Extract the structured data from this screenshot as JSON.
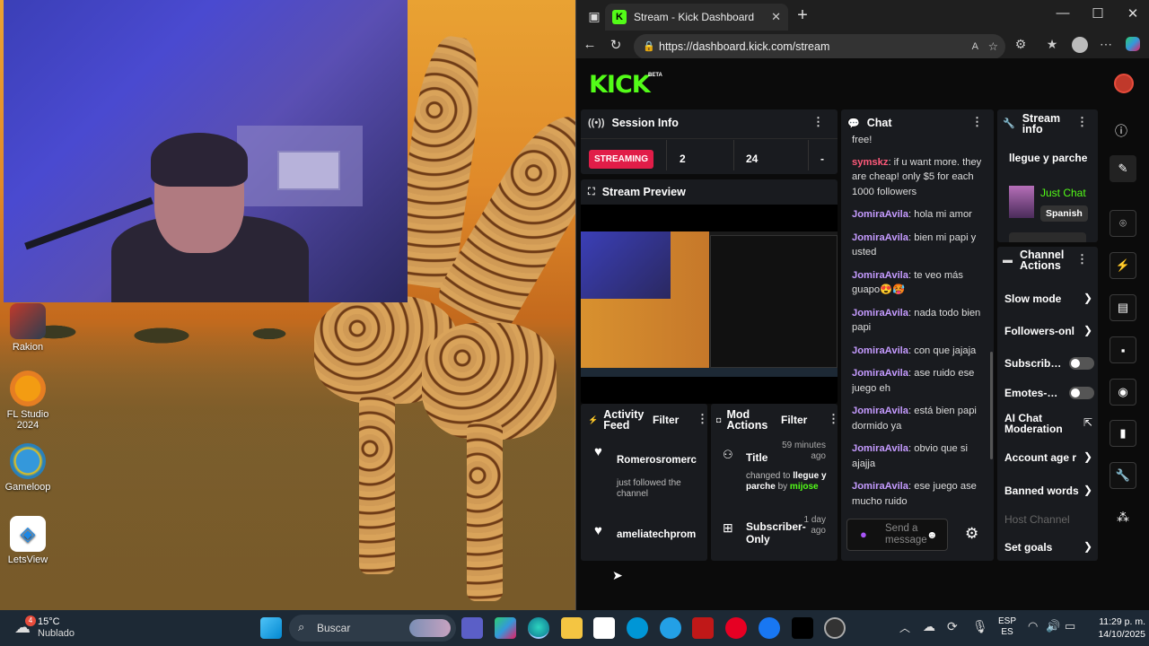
{
  "desktop": {
    "icons": [
      {
        "name": "Rakion"
      },
      {
        "name": "FL Studio 2024"
      },
      {
        "name": "Gameloop"
      },
      {
        "name": "LetsView"
      }
    ]
  },
  "browser": {
    "tab_title": "Stream - Kick Dashboard",
    "tab_favicon": "K",
    "url": "https://dashboard.kick.com/stream",
    "new_tab": "+",
    "window_controls": [
      "—",
      "☐",
      "✕"
    ]
  },
  "kick": {
    "logo": "KICK",
    "logo_badge": "BETA",
    "brand_color": "#53fc18",
    "session_info": {
      "title": "Session Info",
      "status": "STREAMING",
      "viewers": "2",
      "followers": "24",
      "extra": "-"
    },
    "stream_preview": {
      "title": "Stream Preview"
    },
    "activity_feed": {
      "title": "Activity Feed",
      "filter": "Filter",
      "items": [
        {
          "user": "Romerosromerc",
          "detail": "just followed the channel"
        },
        {
          "user": "ameliatechprom",
          "detail": ""
        }
      ]
    },
    "mod_actions": {
      "title": "Mod Actions",
      "filter": "Filter",
      "items": [
        {
          "label": "Title",
          "time": "59 minutes ago",
          "detail_prefix": "changed to ",
          "detail_value": "llegue y parche",
          "detail_by": " by ",
          "detail_user": "mijose"
        },
        {
          "label": "Subscriber-Only",
          "time": "1 day ago"
        }
      ]
    },
    "chat": {
      "title": "Chat",
      "messages": [
        {
          "user": "",
          "text": "free!"
        },
        {
          "user": "symskz",
          "text": ": if u want more. they are cheap! only $5 for each 1000 followers",
          "color": "#ff5a7a"
        },
        {
          "user": "JomiraAvila",
          "text": ": hola mi amor",
          "color": "#c59bff"
        },
        {
          "user": "JomiraAvila",
          "text": ": bien mi papi y usted",
          "color": "#c59bff"
        },
        {
          "user": "JomiraAvila",
          "text": ": te veo más guapo😍🥵",
          "color": "#c59bff"
        },
        {
          "user": "JomiraAvila",
          "text": ": nada todo bien papi",
          "color": "#c59bff"
        },
        {
          "user": "JomiraAvila",
          "text": ": con que jajaja",
          "color": "#c59bff"
        },
        {
          "user": "JomiraAvila",
          "text": ": ase ruido ese juego eh",
          "color": "#c59bff"
        },
        {
          "user": "JomiraAvila",
          "text": ": está bien papi dormido ya",
          "color": "#c59bff"
        },
        {
          "user": "JomiraAvila",
          "text": ": obvio que si ajajja",
          "color": "#c59bff"
        },
        {
          "user": "JomiraAvila",
          "text": ": ese juego ase mucho ruido",
          "color": "#c59bff"
        }
      ],
      "send_placeholder": "Send a message"
    },
    "stream_info": {
      "title": "Stream info",
      "stream_title": "llegue y parche",
      "category": "Just Chat",
      "language": "Spanish"
    },
    "channel_actions": {
      "title": "Channel Actions",
      "items": [
        {
          "label": "Slow mode",
          "kind": "arrow"
        },
        {
          "label": "Followers-onl",
          "kind": "arrow"
        },
        {
          "label": "Subscrib…",
          "kind": "toggle"
        },
        {
          "label": "Emotes-…",
          "kind": "toggle"
        },
        {
          "label": "AI Chat Moderation",
          "kind": "external"
        },
        {
          "label": "Account age r",
          "kind": "arrow"
        },
        {
          "label": "Banned words",
          "kind": "arrow"
        },
        {
          "label": "Host Channel",
          "kind": "disabled"
        },
        {
          "label": "Set goals",
          "kind": "arrow"
        }
      ]
    }
  },
  "taskbar": {
    "weather_temp": "15°C",
    "weather_desc": "Nublado",
    "weather_badge": "4",
    "search_label": "Buscar",
    "lang_line1": "ESP",
    "lang_line2": "ES",
    "time": "11:29 p. m.",
    "date": "14/10/2025"
  }
}
